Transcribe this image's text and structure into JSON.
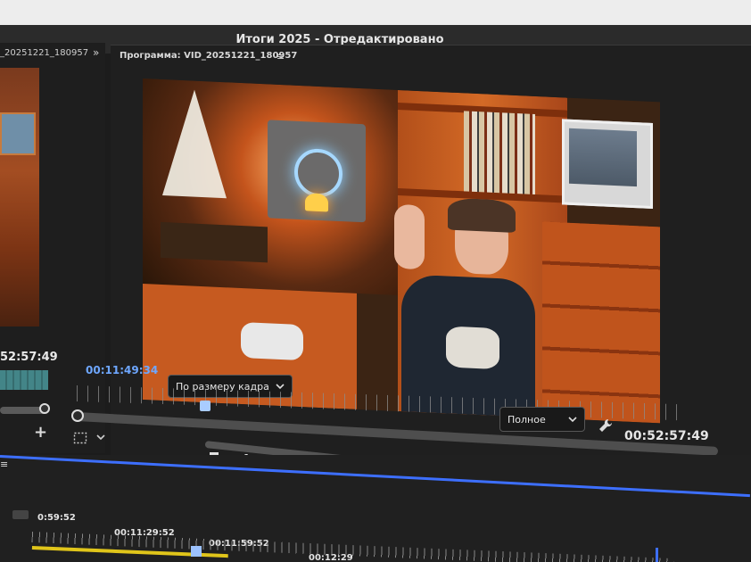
{
  "window": {
    "title": "Итоги 2025 - Отредактировано"
  },
  "source_panel": {
    "tab_label": "_20251221_180957",
    "menu_chevrons": "»",
    "timecode": "52:57:49",
    "add_symbol": "+"
  },
  "program_panel": {
    "header": "Программа: VID_20251221_180957",
    "menu_symbol": "≡",
    "timecode_current": "00:11:49:34",
    "timecode_duration": "00:52:57:49",
    "fit_select": {
      "value": "По размеру кадра"
    },
    "quality_select": {
      "value": "Полное"
    },
    "add_symbol": "+"
  },
  "transport": {
    "mark_in": "{",
    "mark_out": "}",
    "go_to_in": "{←",
    "step_back": "◂|",
    "play": "▶",
    "step_forward": "|▸",
    "go_to_out": "→}"
  },
  "timeline": {
    "menu_symbol": "≡",
    "times": [
      "0:59:52",
      "00:11:29:52",
      "00:11:59:52",
      "00:12:29"
    ]
  }
}
